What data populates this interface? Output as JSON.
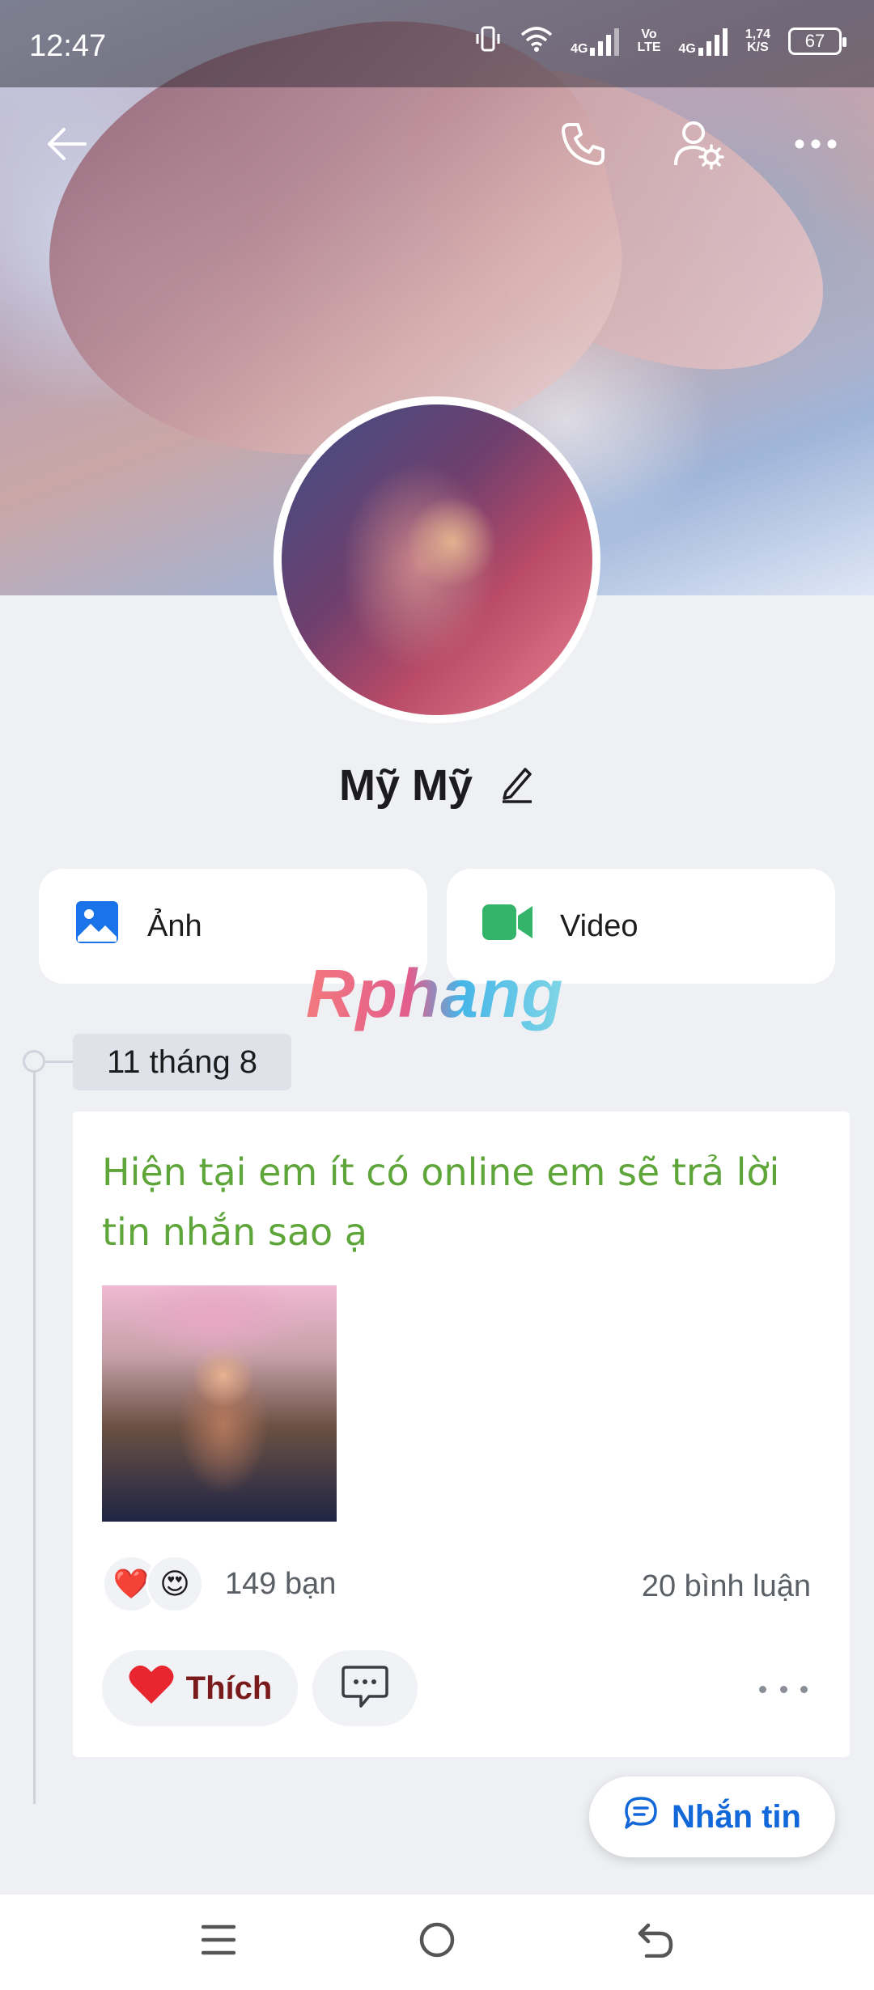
{
  "status_bar": {
    "time": "12:47",
    "network_1": "4G",
    "volte_top": "Vo",
    "volte_bottom": "LTE",
    "network_2": "4G",
    "speed_top": "1,74",
    "speed_bottom": "K/S",
    "battery": "67"
  },
  "header": {
    "back_icon": "arrow-left-icon",
    "call_icon": "phone-icon",
    "settings_icon": "user-settings-icon",
    "more_icon": "more-horizontal-icon"
  },
  "profile": {
    "name": "Mỹ Mỹ",
    "edit_icon": "pencil-icon"
  },
  "media_cards": [
    {
      "label": "Ảnh",
      "icon": "image-icon",
      "color": "#1a73e8"
    },
    {
      "label": "Video",
      "icon": "video-camera-icon",
      "color": "#34b36a"
    }
  ],
  "watermark": "Rphang",
  "timeline": {
    "date": "11 tháng 8",
    "post": {
      "text": "Hiện tại em ít có online em sẽ trả lời tin nhắn sao ạ",
      "text_color": "#5fa63a",
      "reactions": [
        "❤️",
        "😍"
      ],
      "reaction_count": "149 bạn",
      "comment_count": "20 bình luận",
      "like_label": "Thích"
    }
  },
  "message_button": {
    "label": "Nhắn tin",
    "color": "#1268d8"
  },
  "navbar": {
    "menu_icon": "menu-icon",
    "home_icon": "home-circle-icon",
    "back_icon": "back-arrow-icon"
  }
}
